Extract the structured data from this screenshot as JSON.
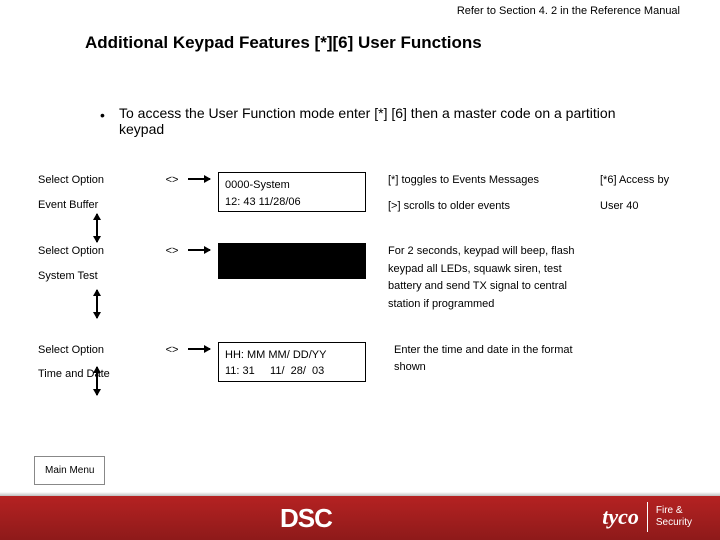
{
  "header": {
    "ref": "Refer to Section 4. 2 in the Reference Manual"
  },
  "title": "Additional Keypad Features [*][6] User Functions",
  "intro": "To access the User Function mode enter [*] [6] then a master code on a partition keypad",
  "rows": [
    {
      "left_a": "Select Option",
      "left_b": "Event Buffer",
      "arrow": "<>",
      "box_a": "0000-System",
      "box_b": "12: 43 11/28/06",
      "desc_a": "[*] toggles to Events Messages",
      "desc_b": "[>] scrolls to older events",
      "right_a": "[*6] Access by",
      "right_b": "User 40"
    },
    {
      "left_a": "Select Option",
      "left_b": "System Test",
      "arrow": "<>",
      "box_a": "",
      "box_b": "",
      "desc_a": "For 2 seconds, keypad will beep, flash keypad all LEDs, squawk siren, test battery and send TX signal to central station if programmed",
      "desc_b": "",
      "right_a": "",
      "right_b": ""
    },
    {
      "left_a": "Select Option",
      "left_b": "Time and Date",
      "arrow": "<>",
      "box_a": "HH: MM  MM/ DD/YY",
      "box_b": "11: 31     11/  28/  03",
      "desc_a": "Enter the time and date in the format shown",
      "desc_b": "",
      "right_a": "",
      "right_b": ""
    }
  ],
  "mainMenu": "Main Menu",
  "footer": {
    "dsc": "DSC",
    "tyco": "tyco",
    "fire": "Fire &",
    "security": "Security"
  }
}
